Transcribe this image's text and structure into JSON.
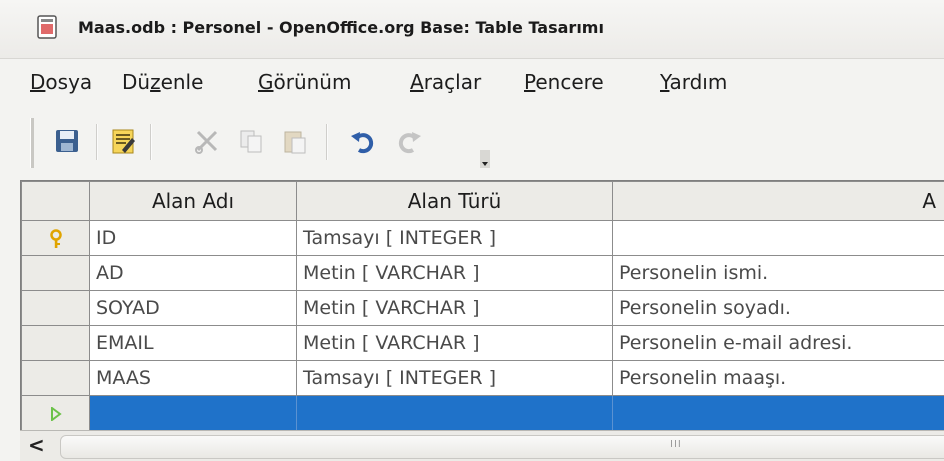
{
  "window": {
    "title": "Maas.odb : Personel - OpenOffice.org Base: Table Tasarımı"
  },
  "menu": {
    "items": [
      {
        "mnemonic": "D",
        "rest": "osya"
      },
      {
        "pre": "Dü",
        "mnemonic": "z",
        "rest": "enle"
      },
      {
        "mnemonic": "G",
        "rest": "örünüm"
      },
      {
        "mnemonic": "A",
        "rest": "raçlar"
      },
      {
        "mnemonic": "P",
        "rest": "encere"
      },
      {
        "mnemonic": "Y",
        "rest": "ardım"
      }
    ]
  },
  "toolbar": {
    "icons": [
      "save-icon",
      "edit-icon",
      "cut-icon",
      "copy-icon",
      "paste-icon",
      "undo-icon",
      "redo-icon"
    ]
  },
  "table": {
    "columns": [
      "Alan Adı",
      "Alan Türü",
      "A"
    ],
    "rows": [
      {
        "name": "ID",
        "type": "Tamsayı [ INTEGER ]",
        "desc": "",
        "primary_key": true
      },
      {
        "name": "AD",
        "type": "Metin [ VARCHAR ]",
        "desc": "Personelin ismi."
      },
      {
        "name": "SOYAD",
        "type": "Metin [ VARCHAR ]",
        "desc": "Personelin soyadı."
      },
      {
        "name": "EMAIL",
        "type": "Metin [ VARCHAR ]",
        "desc": "Personelin e-mail adresi."
      },
      {
        "name": "MAAS",
        "type": "Tamsayı [ INTEGER ]",
        "desc": "Personelin maaşı."
      }
    ]
  },
  "colors": {
    "selection": "#1f72c9",
    "key_icon": "#e0a400",
    "new_row_arrow": "#6cc24a"
  }
}
